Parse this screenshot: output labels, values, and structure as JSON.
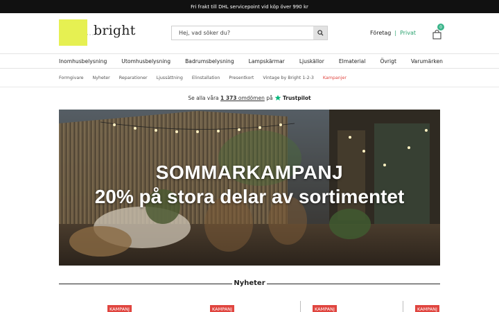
{
  "topbar": {
    "text": "Fri frakt till DHL servicepoint vid köp över 990 kr"
  },
  "header": {
    "logo_text": "bright",
    "logo_sub": "ᵗᵒᵘ⁻ᵒ",
    "search_placeholder": "Hej, vad söker du?",
    "segment_business": "Företag",
    "segment_separator": "|",
    "segment_private": "Privat",
    "cart_count": "0"
  },
  "main_nav": [
    "Inomhusbelysning",
    "Utomhusbelysning",
    "Badrumsbelysning",
    "Lampskärmar",
    "Ljuskällor",
    "Elmaterial",
    "Övrigt",
    "Varumärken"
  ],
  "sub_nav": [
    "Formgivare",
    "Nyheter",
    "Reparationer",
    "Ljussättning",
    "Elinstallation",
    "Presentkort",
    "Vintage by Bright 1-2-3",
    "Kampanjer"
  ],
  "sub_nav_active": "Kampanjer",
  "trustbar": {
    "prefix": "Se alla våra ",
    "count": "1 373",
    "reviews": " omdömen",
    "suffix": " på ",
    "brand": "Trustpilot"
  },
  "hero": {
    "line1": "SOMMARKAMPANJ",
    "line2": "20% på stora delar av sortimentet"
  },
  "section": {
    "title": "Nyheter"
  },
  "product_badges": [
    "KAMPANJ",
    "KAMPANJ",
    "KAMPANJ",
    "KAMPANJ"
  ],
  "colors": {
    "accent_green": "#2aa36f",
    "logo_yellow": "#e6f052",
    "campaign_red": "#e0453f",
    "trustpilot_green": "#00b67a"
  }
}
